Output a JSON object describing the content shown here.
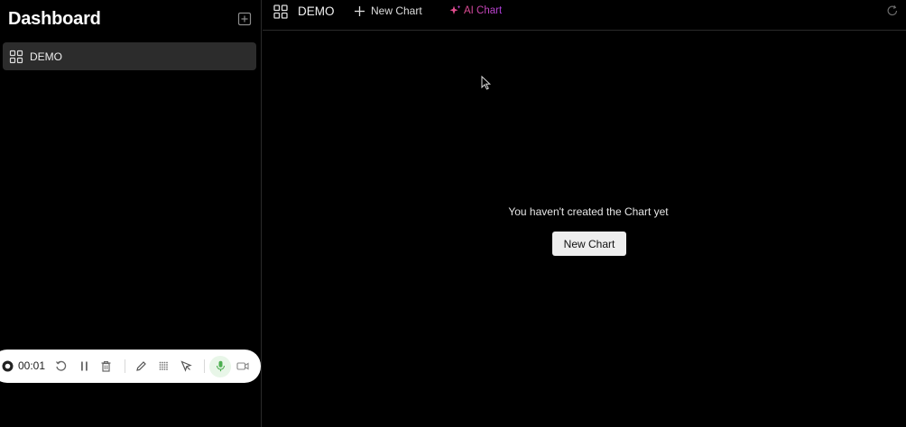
{
  "sidebar": {
    "title": "Dashboard",
    "items": [
      {
        "label": "DEMO",
        "icon": "dashboard-grid-icon"
      }
    ]
  },
  "topbar": {
    "dashboard_name": "DEMO",
    "new_chart_label": "New Chart",
    "ai_chart_label": "AI Chart",
    "refresh_icon": "refresh-icon"
  },
  "main": {
    "empty_message": "You haven't created the Chart yet",
    "new_chart_button": "New Chart"
  },
  "recorder": {
    "elapsed": "00:01",
    "tools": [
      "record-icon",
      "restart-icon",
      "pause-icon",
      "trash-icon",
      "pen-icon",
      "grid-icon",
      "pointer-icon",
      "mic-icon",
      "camera-icon"
    ]
  },
  "colors": {
    "background": "#000000",
    "sidebar_item_active": "#2c2c2c",
    "ai_gradient_start": "#e34d8e",
    "ai_gradient_end": "#b03fe0",
    "button_bg": "#eeeeee",
    "mic_active": "#4caf50"
  }
}
